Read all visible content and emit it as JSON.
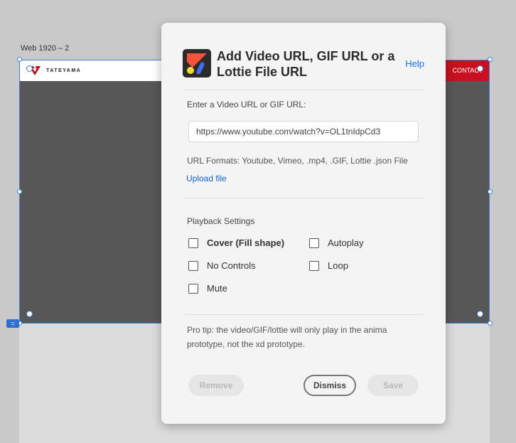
{
  "canvas": {
    "artboard_label": "Web 1920 – 2",
    "site": {
      "logo_text": "TATEYAMA",
      "contact_label": "CONTACT"
    },
    "side_button_glyph": "="
  },
  "dialog": {
    "title": "Add Video URL, GIF URL or a Lottie File URL",
    "help_label": "Help",
    "url_prompt": "Enter a Video URL or GIF URL:",
    "url_value": "https://www.youtube.com/watch?v=OL1tnIdpCd3",
    "url_formats": "URL Formats: Youtube, Vimeo, .mp4, .GIF, Lottie .json File",
    "upload_label": "Upload file",
    "playback_title": "Playback Settings",
    "options": {
      "cover": "Cover (Fill shape)",
      "autoplay": "Autoplay",
      "no_controls": "No Controls",
      "loop": "Loop",
      "mute": "Mute"
    },
    "pro_tip": "Pro tip: the video/GIF/lottie will only play in the anima prototype, not the xd prototype.",
    "buttons": {
      "remove": "Remove",
      "dismiss": "Dismiss",
      "save": "Save"
    }
  },
  "colors": {
    "brand_red": "#c8101e",
    "selection_blue": "#3f7fd6",
    "link_blue": "#1473e6"
  }
}
